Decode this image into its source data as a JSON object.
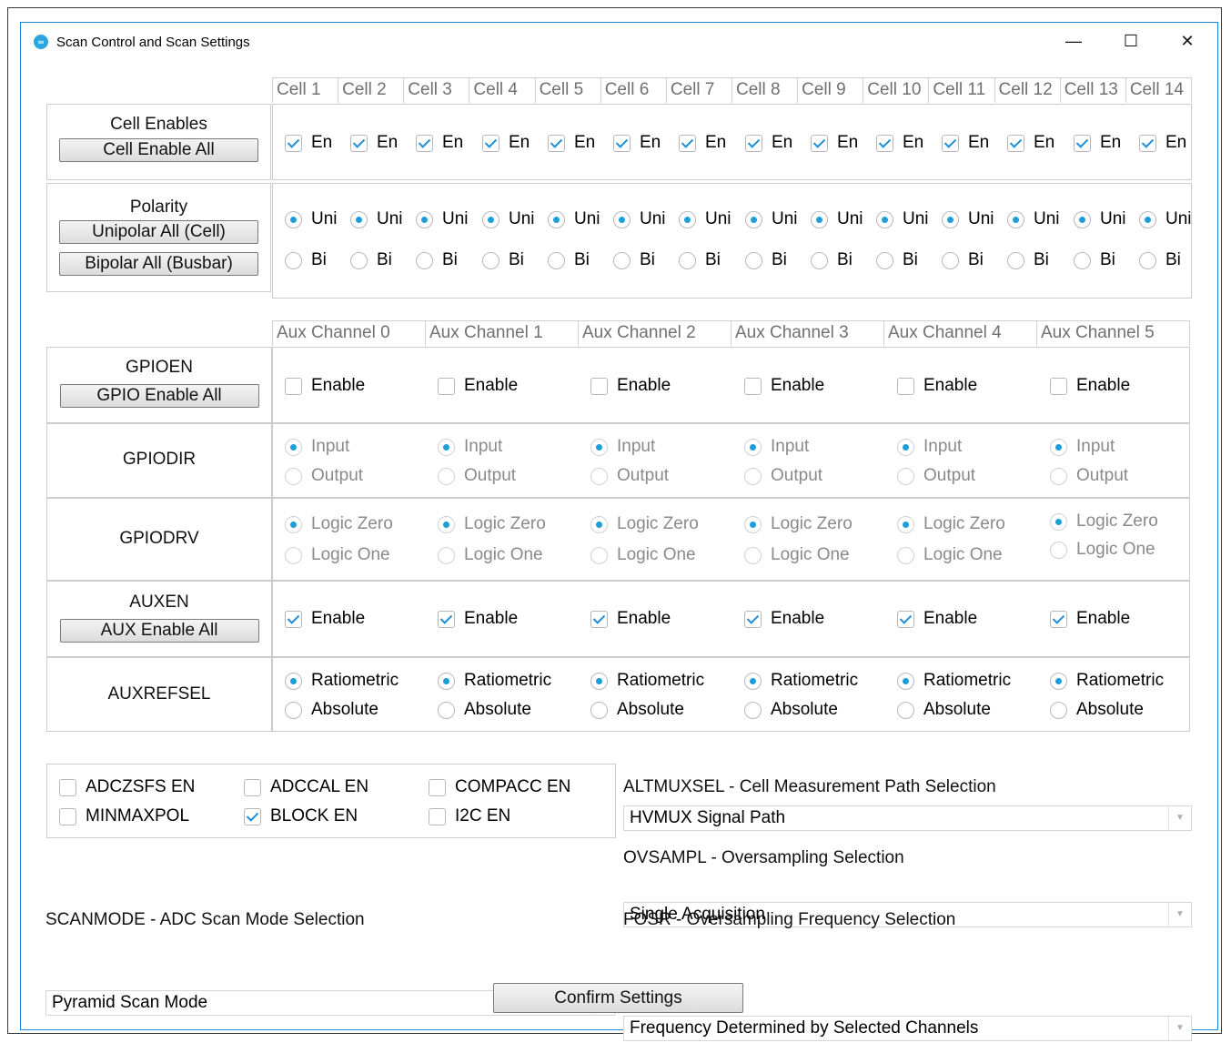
{
  "window": {
    "title": "Scan Control and Scan Settings",
    "icon": "maxim-logo-icon",
    "minimize": "—",
    "maximize": "☐",
    "close": "✕"
  },
  "cells": {
    "headers": [
      "Cell 1",
      "Cell 2",
      "Cell 3",
      "Cell 4",
      "Cell 5",
      "Cell 6",
      "Cell 7",
      "Cell 8",
      "Cell 9",
      "Cell 10",
      "Cell 11",
      "Cell 12",
      "Cell 13",
      "Cell 14"
    ],
    "enables_label": "Cell Enables",
    "enable_all_button": "Cell Enable All",
    "en_label": "En",
    "enabled": [
      true,
      true,
      true,
      true,
      true,
      true,
      true,
      true,
      true,
      true,
      true,
      true,
      true,
      true
    ],
    "polarity_label": "Polarity",
    "unipolar_all_button": "Unipolar All (Cell)",
    "bipolar_all_button": "Bipolar All (Busbar)",
    "uni_label": "Uni",
    "bi_label": "Bi",
    "polarity_selected": [
      "Uni",
      "Uni",
      "Uni",
      "Uni",
      "Uni",
      "Uni",
      "Uni",
      "Uni",
      "Uni",
      "Uni",
      "Uni",
      "Uni",
      "Uni",
      "Uni"
    ]
  },
  "aux": {
    "headers": [
      "Aux Channel 0",
      "Aux Channel 1",
      "Aux Channel 2",
      "Aux Channel 3",
      "Aux Channel 4",
      "Aux Channel 5"
    ],
    "gpioen": {
      "label": "GPIOEN",
      "button": "GPIO Enable All",
      "option": "Enable",
      "values": [
        false,
        false,
        false,
        false,
        false,
        false
      ]
    },
    "gpiodir": {
      "label": "GPIODIR",
      "options": [
        "Input",
        "Output"
      ],
      "selected": "Input"
    },
    "gpiodrv": {
      "label": "GPIODRV",
      "options": [
        "Logic Zero",
        "Logic One"
      ],
      "selected": "Logic Zero"
    },
    "auxen": {
      "label": "AUXEN",
      "button": "AUX Enable All",
      "option": "Enable",
      "values": [
        true,
        true,
        true,
        true,
        true,
        true
      ]
    },
    "auxrefsel": {
      "label": "AUXREFSEL",
      "options": [
        "Ratiometric",
        "Absolute"
      ],
      "selected": "Ratiometric"
    }
  },
  "flags": [
    {
      "label": "ADCZSFS EN",
      "checked": false
    },
    {
      "label": "ADCCAL EN",
      "checked": false
    },
    {
      "label": "COMPACC EN",
      "checked": false
    },
    {
      "label": "MINMAXPOL",
      "checked": false
    },
    {
      "label": "BLOCK EN",
      "checked": true
    },
    {
      "label": "I2C EN",
      "checked": false
    }
  ],
  "altmuxsel": {
    "label": "ALTMUXSEL - Cell Measurement Path Selection",
    "value": "HVMUX Signal Path"
  },
  "ovsampl": {
    "label": "OVSAMPL - Oversampling Selection",
    "value": "Single Acquisition"
  },
  "scanmode": {
    "label": "SCANMODE - ADC Scan Mode Selection",
    "value": "Pyramid Scan Mode"
  },
  "fosr": {
    "label": "FOSR - Oversampling Frequency Selection",
    "value": "Frequency Determined by Selected Channels"
  },
  "confirm_button": "Confirm Settings",
  "colors": {
    "accent": "#1e9ed8",
    "window_border": "#1e86d8",
    "grid_border": "#cccccc",
    "disabled_text": "#8a8a8a"
  }
}
